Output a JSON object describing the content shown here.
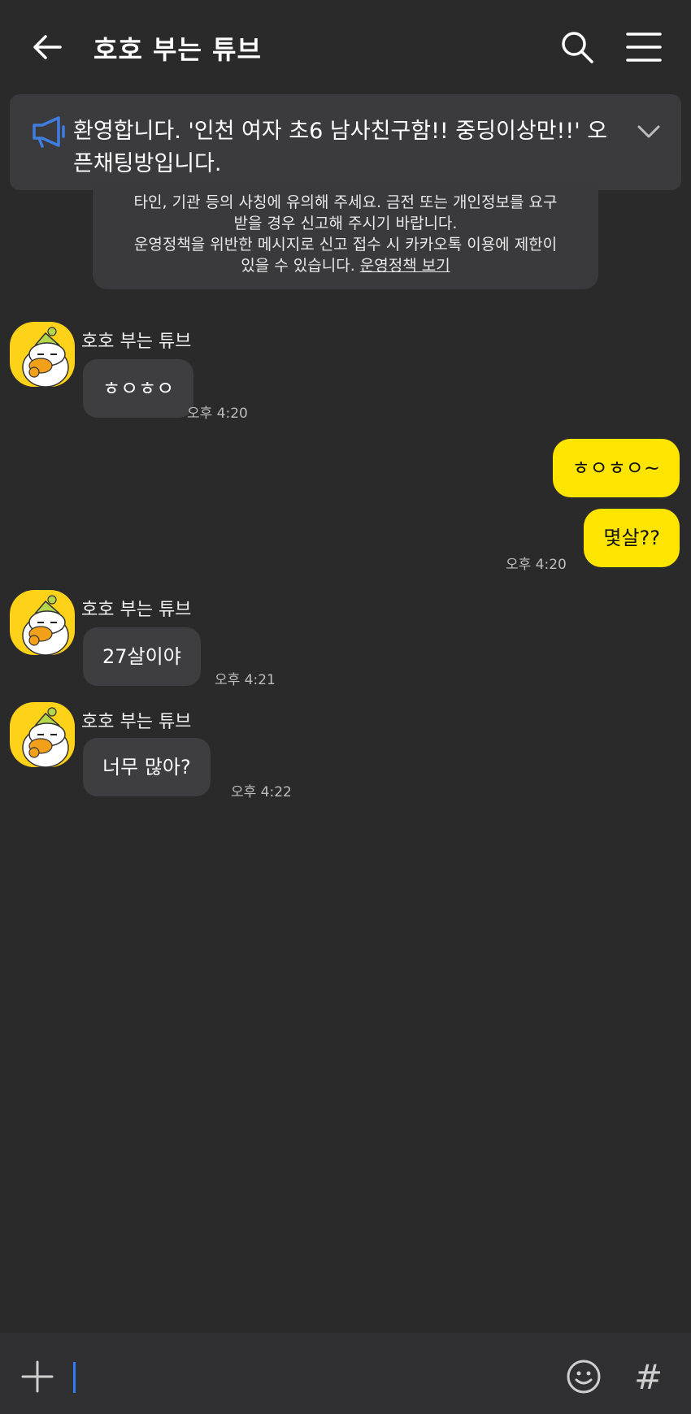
{
  "header": {
    "title": "호호 부는 튜브",
    "back_icon": "back-arrow-icon",
    "search_icon": "search-icon",
    "menu_icon": "hamburger-menu-icon"
  },
  "notice": {
    "text": "환영합니다. '인천 여자 초6 남사친구함!! 중딩이상만!!' 오픈채팅방입니다.",
    "icon": "megaphone-icon",
    "expand_icon": "chevron-down-icon"
  },
  "warning": {
    "line1": "타인, 기관 등의 사칭에 유의해 주세요. 금전 또는 개인정보를 요구",
    "line2": "받을 경우 신고해 주시기 바랍니다.",
    "line3": "운영정책을 위반한 메시지로 신고 접수 시 카카오톡 이용에 제한이",
    "line4_prefix": "있을 수 있습니다. ",
    "policy_link": "운영정책 보기"
  },
  "messages": [
    {
      "sender": "호호 부는 튜브",
      "text": "ㅎㅇㅎㅇ",
      "time": "오후 4:20"
    },
    {
      "text": "ㅎㅇㅎㅇ~"
    },
    {
      "text": "몇살??",
      "time": "오후 4:20"
    },
    {
      "sender": "호호 부는 튜브",
      "text": "27살이야",
      "time": "오후 4:21"
    },
    {
      "sender": "호호 부는 튜브",
      "text": "너무 많아?",
      "time": "오후 4:22"
    }
  ],
  "input": {
    "plus_icon": "plus-icon",
    "emoji_icon": "emoji-icon",
    "hash_label": "#"
  },
  "colors": {
    "background": "#2a2a2b",
    "my_bubble": "#fee500",
    "other_bubble": "#3e3e40",
    "avatar_bg": "#ffd21a",
    "caret": "#2f7cf6",
    "megaphone": "#3f7de0"
  }
}
